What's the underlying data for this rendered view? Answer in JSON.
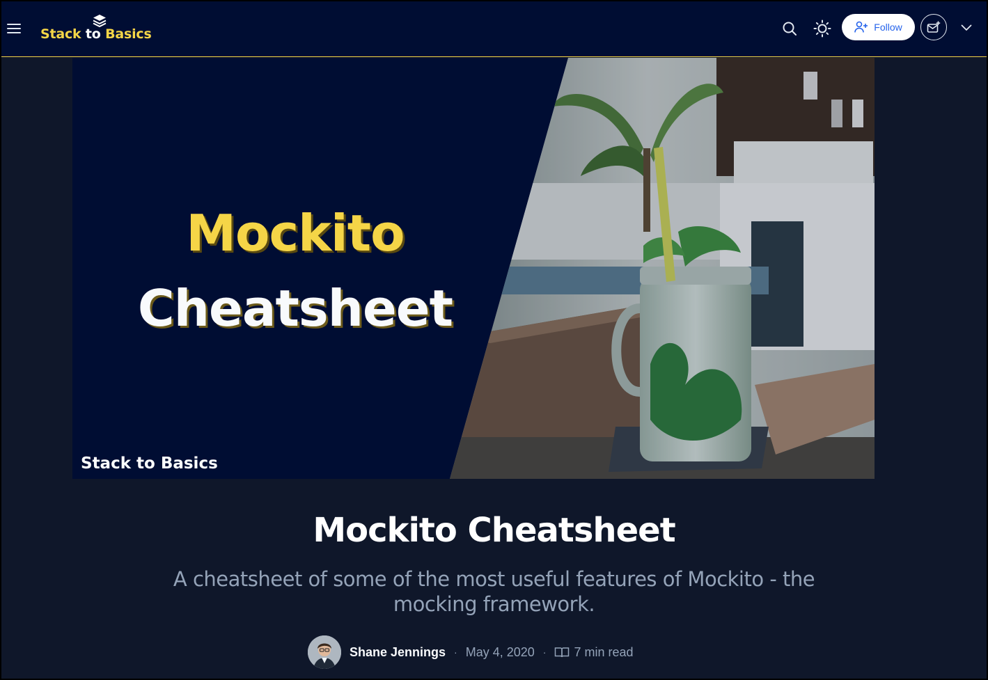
{
  "header": {
    "brand": {
      "part1": "Stack",
      "part2": "to",
      "part3": "Basics"
    },
    "follow_label": "Follow",
    "icons": [
      "menu-icon",
      "stack-logo-icon",
      "search-icon",
      "sun-icon",
      "user-plus-icon",
      "mail-plus-icon",
      "chevron-down-icon"
    ]
  },
  "cover": {
    "title_line1": "Mockito",
    "title_line2": "Cheatsheet",
    "brand": "Stack to Basics"
  },
  "post": {
    "title": "Mockito Cheatsheet",
    "subtitle": "A cheatsheet of some of the most useful features of Mockito - the mocking framework.",
    "author": "Shane Jennings",
    "date": "May 4, 2020",
    "read_time": "7 min read",
    "separator": "·"
  },
  "colors": {
    "header_bg": "#000d33",
    "page_bg": "#0f172a",
    "accent_yellow": "#f5d547",
    "follow_text": "#2563eb",
    "muted_text": "#94a3b8"
  }
}
